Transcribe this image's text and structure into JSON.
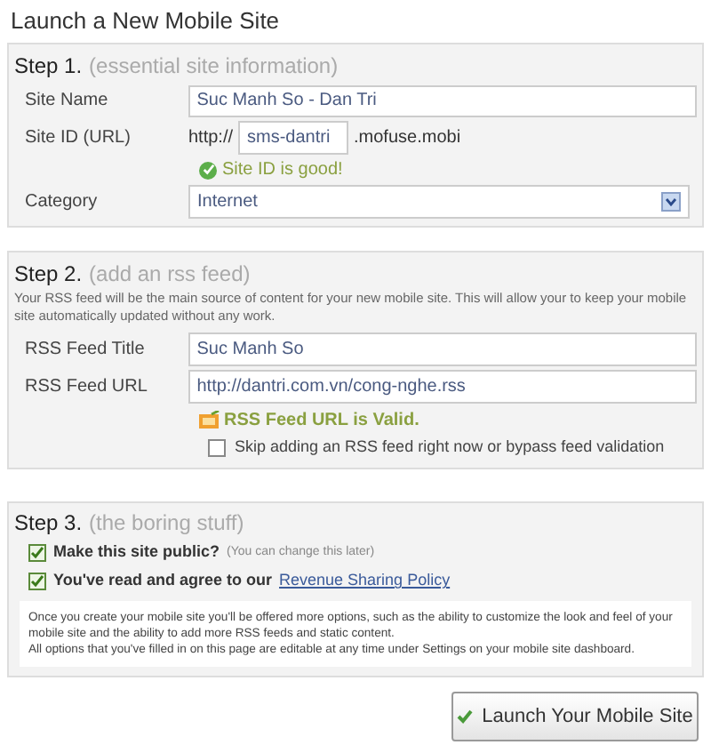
{
  "title": "Launch a New Mobile Site",
  "step1": {
    "step": "Step 1.",
    "subtitle": "(essential site information)",
    "site_name": {
      "label": "Site Name",
      "value": "Suc Manh So - Dan Tri"
    },
    "site_id": {
      "label": "Site ID (URL)",
      "prefix": "http://",
      "value": "sms-dantri",
      "suffix": ".mofuse.mobi"
    },
    "site_id_status": "Site ID is good!",
    "category": {
      "label": "Category",
      "value": "Internet"
    }
  },
  "step2": {
    "step": "Step 2.",
    "subtitle": "(add an rss feed)",
    "description": "Your RSS feed will be the main source of content for your new mobile site. This will allow your to keep your mobile site automatically updated without any work.",
    "feed_title": {
      "label": "RSS Feed Title",
      "value": "Suc Manh So"
    },
    "feed_url": {
      "label": "RSS Feed URL",
      "value": "http://dantri.com.vn/cong-nghe.rss"
    },
    "feed_status": "RSS Feed URL is Valid.",
    "skip": {
      "label": "Skip adding an RSS feed right now or bypass feed validation",
      "checked": false
    }
  },
  "step3": {
    "step": "Step 3.",
    "subtitle": "(the boring stuff)",
    "options": [
      {
        "label": "Make this site public?",
        "note": "(You can change this later)",
        "checked": true
      },
      {
        "label": "You've read and agree to our",
        "link": "Revenue Sharing Policy",
        "checked": true
      }
    ],
    "info": [
      "Once you create your mobile site you'll be offered more options, such as the ability to customize the look and feel of your mobile site and the ability to add more RSS feeds and static content.",
      "All options that you've filled in on this page are editable at any time under Settings on your mobile site dashboard."
    ]
  },
  "launch_button": "Launch Your Mobile Site"
}
